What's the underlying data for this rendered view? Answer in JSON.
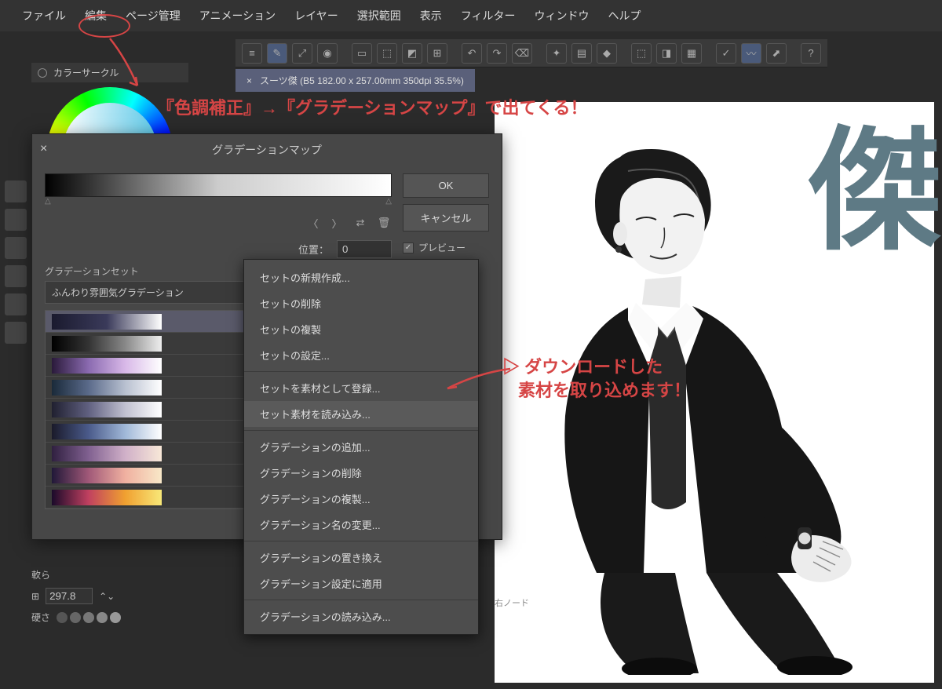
{
  "menu": {
    "file": "ファイル",
    "edit": "編集",
    "page": "ページ管理",
    "anim": "アニメーション",
    "layer": "レイヤー",
    "select": "選択範囲",
    "view": "表示",
    "filter": "フィルター",
    "window": "ウィンドウ",
    "help": "ヘルプ"
  },
  "doc": {
    "close": "×",
    "title": "スーツ傑 (B5 182.00 x 257.00mm 350dpi 35.5%)"
  },
  "colorPanel": {
    "title": "カラーサークル"
  },
  "dialog": {
    "title": "グラデーションマップ",
    "ok": "OK",
    "cancel": "キャンセル",
    "preview": "プレビュー",
    "position_label": "位置：",
    "position_value": "0",
    "set_label": "グラデーションセット",
    "set_name": "ふんわり雰囲気グラデーション",
    "gradients": [
      {
        "css": "linear-gradient(90deg,#1a1a2e,#3a3a5a,#fff)"
      },
      {
        "css": "linear-gradient(90deg,#000,#333,#888,#eee)"
      },
      {
        "css": "linear-gradient(90deg,#2a1a3a,#8a6ab0,#d8b8e8,#fff)"
      },
      {
        "css": "linear-gradient(90deg,#1a2a3a,#5a6a8a,#b8c0d0,#fff)"
      },
      {
        "css": "linear-gradient(90deg,#202030,#606080,#c0c0d0,#fff)"
      },
      {
        "css": "linear-gradient(90deg,#1a1a2a,#4a5a8a,#a0b8d8,#fff)"
      },
      {
        "css": "linear-gradient(90deg,#302040,#806090,#d0b0c8,#f8e8d8)"
      },
      {
        "css": "linear-gradient(90deg,#201838,#a05878,#f0b0a0,#f8e8c8)"
      },
      {
        "css": "linear-gradient(90deg,#1a0a2a,#c04060,#f0a030,#f8e878)"
      }
    ]
  },
  "context": {
    "items": [
      {
        "label": "セットの新規作成...",
        "sep": false
      },
      {
        "label": "セットの削除",
        "sep": false
      },
      {
        "label": "セットの複製",
        "sep": false
      },
      {
        "label": "セットの設定...",
        "sep": true
      },
      {
        "label": "セットを素材として登録...",
        "sep": false
      },
      {
        "label": "セット素材を読み込み...",
        "sep": true,
        "hl": true
      },
      {
        "label": "グラデーションの追加...",
        "sep": false
      },
      {
        "label": "グラデーションの削除",
        "sep": false
      },
      {
        "label": "グラデーションの複製...",
        "sep": false
      },
      {
        "label": "グラデーション名の変更...",
        "sep": true
      },
      {
        "label": "グラデーションの置き換え",
        "sep": false
      },
      {
        "label": "グラデーション設定に適用",
        "sep": true
      },
      {
        "label": "グラデーションの読み込み...",
        "sep": false
      }
    ]
  },
  "canvas": {
    "kanji": "傑"
  },
  "props": {
    "brush_size": "297.8",
    "hardness": "硬さ",
    "soft_label": "軟ら"
  },
  "rightnode": "右ノード",
  "anno": {
    "a1": "『色調補正』→『グラデーションマップ』で出てくる！",
    "a2": "▷ ダウンロードした",
    "a3": "素材を取り込めます！"
  }
}
